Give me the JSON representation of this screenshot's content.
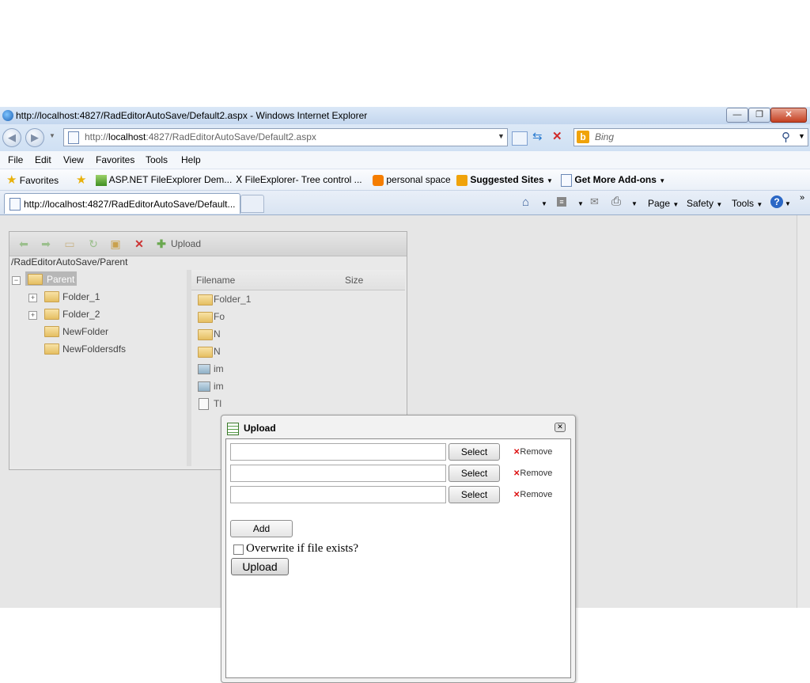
{
  "window": {
    "title": "http://localhost:4827/RadEditorAutoSave/Default2.aspx - Windows Internet Explorer",
    "minimize": "—",
    "restore": "❐",
    "close": "✕"
  },
  "address": {
    "prefix": "http://",
    "host": "localhost",
    "rest": ":4827/RadEditorAutoSave/Default2.aspx"
  },
  "search": {
    "placeholder": "Bing"
  },
  "menubar": [
    "File",
    "Edit",
    "View",
    "Favorites",
    "Tools",
    "Help"
  ],
  "favorites": {
    "label": "Favorites",
    "items": [
      "ASP.NET FileExplorer Dem...",
      "FileExplorer- Tree control ...",
      "personal space",
      "Suggested Sites",
      "Get More Add-ons"
    ]
  },
  "tab": {
    "title": "http://localhost:4827/RadEditorAutoSave/Default..."
  },
  "commandbar": {
    "page": "Page",
    "safety": "Safety",
    "tools": "Tools"
  },
  "fileexplorer": {
    "toolbar_upload": "Upload",
    "path": "/RadEditorAutoSave/Parent",
    "tree": {
      "root": "Parent",
      "children": [
        "Folder_1",
        "Folder_2",
        "NewFolder",
        "NewFoldersdfs"
      ]
    },
    "grid": {
      "headers": {
        "filename": "Filename",
        "size": "Size"
      },
      "rows": [
        "Folder_1",
        "Fo",
        "N",
        "N",
        "im",
        "im",
        "Tl"
      ]
    }
  },
  "upload_dialog": {
    "title": "Upload",
    "select_label": "Select",
    "remove_label": "Remove",
    "add_label": "Add",
    "overwrite_label": "Overwrite if file exists?",
    "upload_label": "Upload"
  }
}
